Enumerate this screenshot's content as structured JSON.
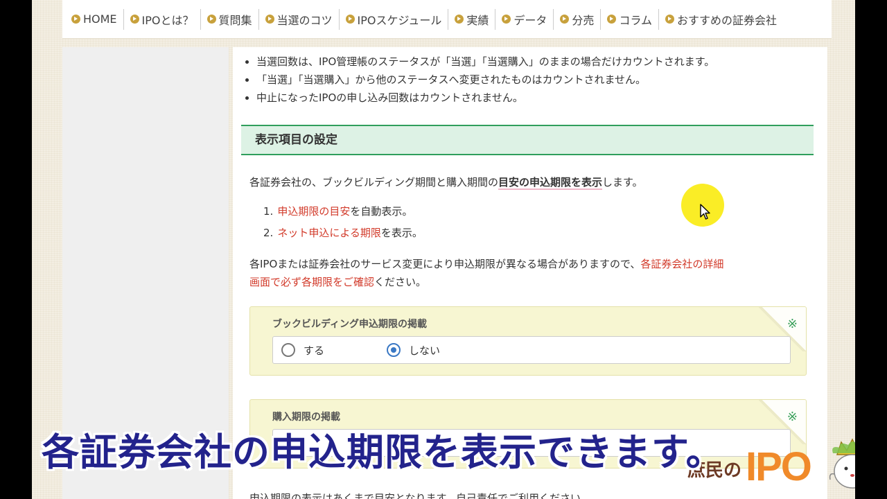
{
  "nav": {
    "items": [
      "HOME",
      "IPOとは？",
      "質問集",
      "当選のコツ",
      "IPOスケジュール",
      "実績",
      "データ",
      "分売",
      "コラム",
      "おすすめの証券会社"
    ]
  },
  "bullets": [
    "当選回数は、IPO管理帳のステータスが「当選」「当選購入」のままの場合だけカウントされます。",
    "「当選」「当選購入」から他のステータスへ変更されたものはカウントされません。",
    "中止になったIPOの申し込み回数はカウントされません。"
  ],
  "section": {
    "title": "表示項目の設定"
  },
  "intro": {
    "before": "各証券会社の、ブックビルディング期間と購入期間の",
    "highlight": "目安の申込期限を表示",
    "after": "します。"
  },
  "numbered": [
    {
      "num": "1.",
      "red": "申込期限の目安",
      "rest": "を自動表示。"
    },
    {
      "num": "2.",
      "red": "ネット申込による期限",
      "rest": "を表示。"
    }
  ],
  "notice": {
    "line1_plain": "各IPOまたは証券会社のサービス変更により申込期限が異なる場合がありますので、",
    "line1_red": "各証券会社の詳細",
    "line2_red": "画面で必ず各期限をご確認",
    "line2_plain": "ください。"
  },
  "option1": {
    "title": "ブックビルディング申込期限の掲載",
    "mark": "※",
    "yes_label": "する",
    "no_label": "しない",
    "selected": "しない"
  },
  "option2": {
    "title": "購入期限の掲載",
    "mark": "※"
  },
  "footer_partial": "申込期限の表示はあくまで目安となります。自己責任でご利用ください。",
  "caption": "各証券会社の申込期限を表示できます。",
  "logo": {
    "left": "庶民の",
    "right": "IPO"
  },
  "colors": {
    "accent_green": "#2f9e5c",
    "red_text": "#d23a2a",
    "caption": "#23238c",
    "logo_orange": "#f08a2a",
    "radio_blue": "#3a78c4"
  }
}
